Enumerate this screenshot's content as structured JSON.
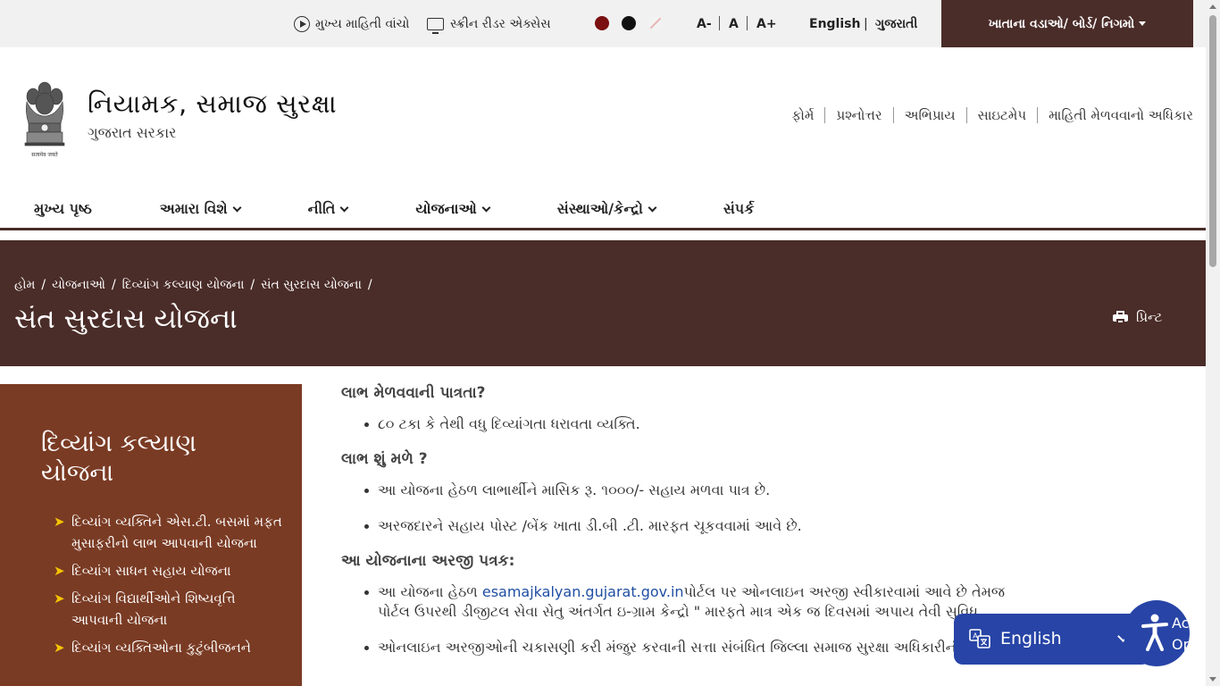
{
  "topbar": {
    "listen_label": "મુખ્ય માહિતી વાંચો",
    "screen_reader_label": "સ્ક્રીન રીડર એક્સેસ",
    "contrast_colors": [
      "#7a1010",
      "#111111",
      "#f3f3f3"
    ],
    "font_decrease": "A-",
    "font_normal": "A",
    "font_increase": "A+",
    "lang_english": "English",
    "lang_separator": "|",
    "lang_gujarati": "ગુજરાતી",
    "departments_label": "ખાતાના વડાઓ/ બોર્ડ/ નિગમો"
  },
  "header": {
    "emblem_caption": "सत्यमेव जयते",
    "title": "નિયામક, સમાજ સુરક્ષા",
    "subtitle": "ગુજરાત સરકાર",
    "quick_links": [
      "ફોર્મ",
      "પ્રશ્નોત્તર",
      "અભિપ્રાય",
      "સાઇટમેપ",
      "માહિતી મેળવવાનો અધિકાર"
    ]
  },
  "nav": {
    "items": [
      {
        "label": "મુખ્ય પૃષ્ઠ",
        "dropdown": false
      },
      {
        "label": "અમારા વિશે",
        "dropdown": true
      },
      {
        "label": "નીતિ",
        "dropdown": true
      },
      {
        "label": "યોજનાઓ",
        "dropdown": true
      },
      {
        "label": "સંસ્થાઓ/કેન્દ્રો",
        "dropdown": true
      },
      {
        "label": "સંપર્ક",
        "dropdown": false
      }
    ]
  },
  "banner": {
    "breadcrumb": [
      "હોમ",
      "યોજનાઓ",
      "દિવ્યાંગ કલ્યાણ યોજના",
      "સંત સુરદાસ યોજના"
    ],
    "breadcrumb_separator": "/",
    "title": "સંત સુરદાસ યોજના",
    "print_label": "પ્રિન્ટ"
  },
  "sidebar": {
    "title": "દિવ્યાંગ કલ્યાણ યોજના",
    "arrow_glyph": "➤",
    "items": [
      "દિવ્યાંગ વ્યક્તિને એસ.ટી. બસમાં મફત મુસાફરીનો લાભ આપવાની યોજના",
      "દિવ્યાંગ સાધન સહાય યોજના",
      "દિવ્યાંગ વિદ્યાર્થીઓને શિષ્યવૃત્તિ આપવાની યોજના",
      "દિવ્યાંગ વ્યક્તિઓના કુટુંબીજનને"
    ]
  },
  "content": {
    "eligibility_heading": "લાભ મેળવવાની પાત્રતા?",
    "eligibility_items": [
      "૮૦ ટકા કે તેથી વધુ દિવ્યાંગતા ધરાવતા વ્યક્તિ."
    ],
    "benefit_heading": "લાભ શું મળે ?",
    "benefit_items": [
      "આ યોજના હેઠળ લાભાર્થીને માસિક રૂ. ૧૦૦૦/- સહાય મળવા પાત્ર છે.",
      "અરજદારને સહાય પોસ્ટ /બેંક ખાતા ડી.બી .ટી. મારફત ચૂકવવામાં આવે છે."
    ],
    "application_heading": "આ યોજનાના અરજી પત્રક:",
    "application_item1_prefix": "આ યોજના હેઠળ ",
    "application_item1_link": "esamajkalyan.gujarat.gov.in",
    "application_item1_suffix": "પોર્ટલ પર ઓનલાઇન અરજી સ્વીકારવામાં આવે છે તેમજ",
    "application_item1_line2": "પોર્ટલ ઉપરથી ડીજીટલ સેવા સેતુ અંતર્ગત ઇ-ગ્રામ કેન્દ્રો \" મારફતે માત્ર એક જ દિવસમાં અપાય તેવી સુવિધ",
    "application_item2": "ઓનલાઇન અરજીઓની ચકાસણી કરી મંજુર કરવાની સત્તા સંબંધિત જિલ્લા સમાજ સુરક્ષા અધિકારીની છે."
  },
  "widgets": {
    "translate_label": "English",
    "accessibility_text_line1": "Ac",
    "accessibility_text_line2": "Op"
  },
  "colors": {
    "brand_dark": "#4a2c28",
    "sidebar_bg": "#7a3b24",
    "arrow": "#f5c400",
    "link": "#1f4ea3",
    "widget_blue": "#2744a6"
  }
}
